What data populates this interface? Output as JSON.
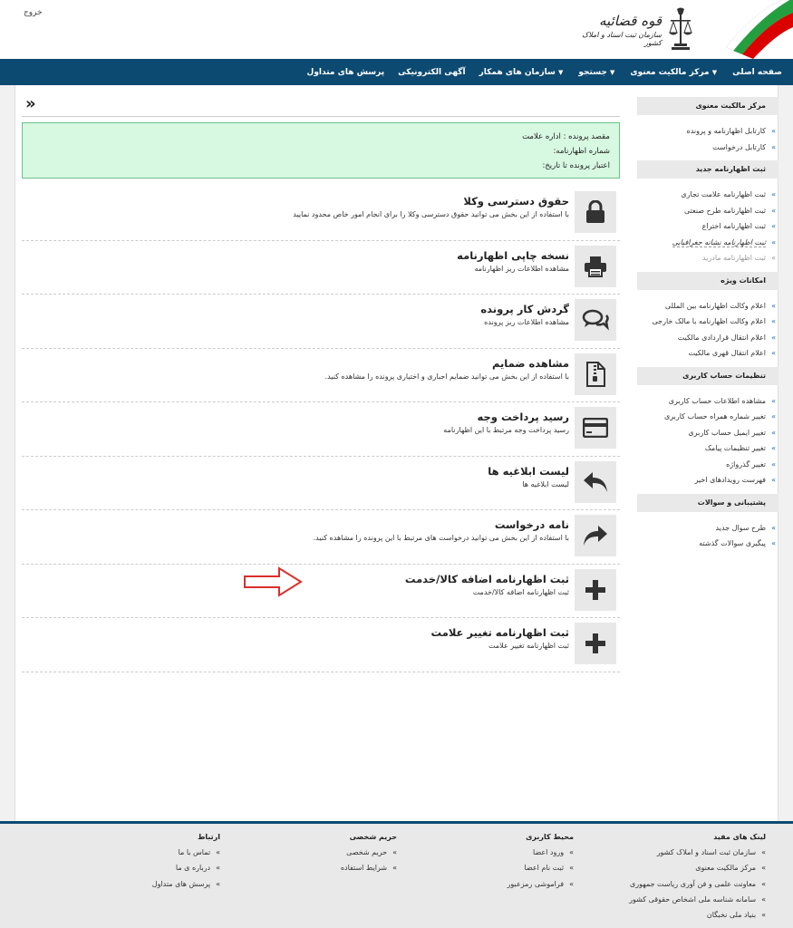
{
  "header": {
    "logout_label": "خروج",
    "logo_title": "قوه قضائیه",
    "logo_subtitle": "سازمان ثبت اسناد و املاک کشور"
  },
  "nav": {
    "items": [
      {
        "label": "صفحه اصلی",
        "dropdown": false
      },
      {
        "label": "مرکز مالکیت معنوی",
        "dropdown": true
      },
      {
        "label": "جستجو",
        "dropdown": true
      },
      {
        "label": "سازمان های همکار",
        "dropdown": true
      },
      {
        "label": "آگهی الکترونیکی",
        "dropdown": false
      },
      {
        "label": "پرسش های متداول",
        "dropdown": false
      }
    ]
  },
  "sidebar": {
    "sections": [
      {
        "title": "مرکز مالکیت معنوی",
        "items": [
          "کارتابل اظهارنامه و پرونده",
          "کارتابل درخواست"
        ]
      },
      {
        "title": "ثبت اظهارنامه جدید",
        "items": [
          "ثبت اظهارنامه علامت تجاری",
          "ثبت اظهارنامه طرح صنعتی",
          "ثبت اظهارنامه اختراع",
          "ثبت اظهارنامه نشانه جغرافیایی",
          "ثبت اظهارنامه مادرید"
        ]
      },
      {
        "title": "امکانات ویژه",
        "items": [
          "اعلام وکالت اظهارنامه بین المللی",
          "اعلام وکالت اظهارنامه با مالک خارجی",
          "اعلام انتقال قراردادی مالکیت",
          "اعلام انتقال قهری مالکیت"
        ]
      },
      {
        "title": "تنظیمات حساب کاربری",
        "items": [
          "مشاهده اطلاعات حساب کاربری",
          "تغییر شماره همراه حساب کاربری",
          "تغییر ایمیل حساب کاربری",
          "تغییر تنظیمات پیامک",
          "تغییر گذرواژه",
          "فهرست رویدادهای اخیر"
        ]
      },
      {
        "title": "پشتیبانی و سوالات",
        "items": [
          "طرح سوال جدید",
          "پیگیری سوالات گذشته"
        ]
      }
    ]
  },
  "content": {
    "back_symbol": "»",
    "info": {
      "line1": "مقصد پرونده : اداره علامت",
      "line2": "شماره اظهارنامه:",
      "line3": "اعتبار پرونده تا تاریخ:"
    },
    "items": [
      {
        "title": "حقوق دسترسی وکلا",
        "desc": "با استفاده از این بخش می توانید حقوق دسترسی وکلا را برای انجام امور خاص محدود نمایید",
        "icon": "lock-icon"
      },
      {
        "title": "نسخه چاپی اظهارنامه",
        "desc": "مشاهده اطلاعات ریز اظهارنامه",
        "icon": "printer-icon"
      },
      {
        "title": "گردش کار پرونده",
        "desc": "مشاهده اطلاعات ریز پرونده",
        "icon": "comments-icon"
      },
      {
        "title": "مشاهده ضمایم",
        "desc": "با استفاده از این بخش می توانید ضمایم اجباری و اختیاری پرونده را مشاهده کنید.",
        "icon": "zip-file-icon"
      },
      {
        "title": "رسید پرداخت وجه",
        "desc": "رسید پرداخت وجه مرتبط با این اظهارنامه",
        "icon": "credit-card-icon"
      },
      {
        "title": "لیست ابلاغیه ها",
        "desc": "لیست ابلاغیه ها",
        "icon": "reply-arrow-icon"
      },
      {
        "title": "نامه درخواست",
        "desc": "با استفاده از این بخش می توانید درخواست های مرتبط با این پرونده را مشاهده کنید.",
        "icon": "forward-arrow-icon"
      },
      {
        "title": "ثبت اظهارنامه اضافه کالا/خدمت",
        "desc": "ثبت اظهارنامه اضافه کالا/خدمت",
        "icon": "plus-icon"
      },
      {
        "title": "ثبت اظهارنامه تغییر علامت",
        "desc": "ثبت اظهارنامه تغییر علامت",
        "icon": "plus-icon"
      }
    ]
  },
  "footer": {
    "columns": [
      {
        "title": "لینک های مفید",
        "items": [
          "سازمان ثبت اسناد و املاک کشور",
          "مرکز مالکیت معنوی",
          "معاونت علمی و فن آوری ریاست جمهوری",
          "سامانه شناسه ملی اشخاص حقوقی کشور",
          "بنیاد ملی نخبگان"
        ]
      },
      {
        "title": "محیط کاربری",
        "items": [
          "ورود اعضا",
          "ثبت نام اعضا",
          "فراموشی رمزعبور"
        ]
      },
      {
        "title": "حریم شخصی",
        "items": [
          "حریم شخصی",
          "شرایط استفاده"
        ]
      },
      {
        "title": "ارتباط",
        "items": [
          "تماس با ما",
          "درباره ی ما",
          "پرسش های متداول"
        ]
      }
    ]
  },
  "colors": {
    "nav_bg": "#0d4a72",
    "info_bg": "#d7f8e1",
    "info_border": "#6cc08a",
    "link_accent": "#1b6fb5",
    "annotation_arrow": "#d9302c"
  }
}
